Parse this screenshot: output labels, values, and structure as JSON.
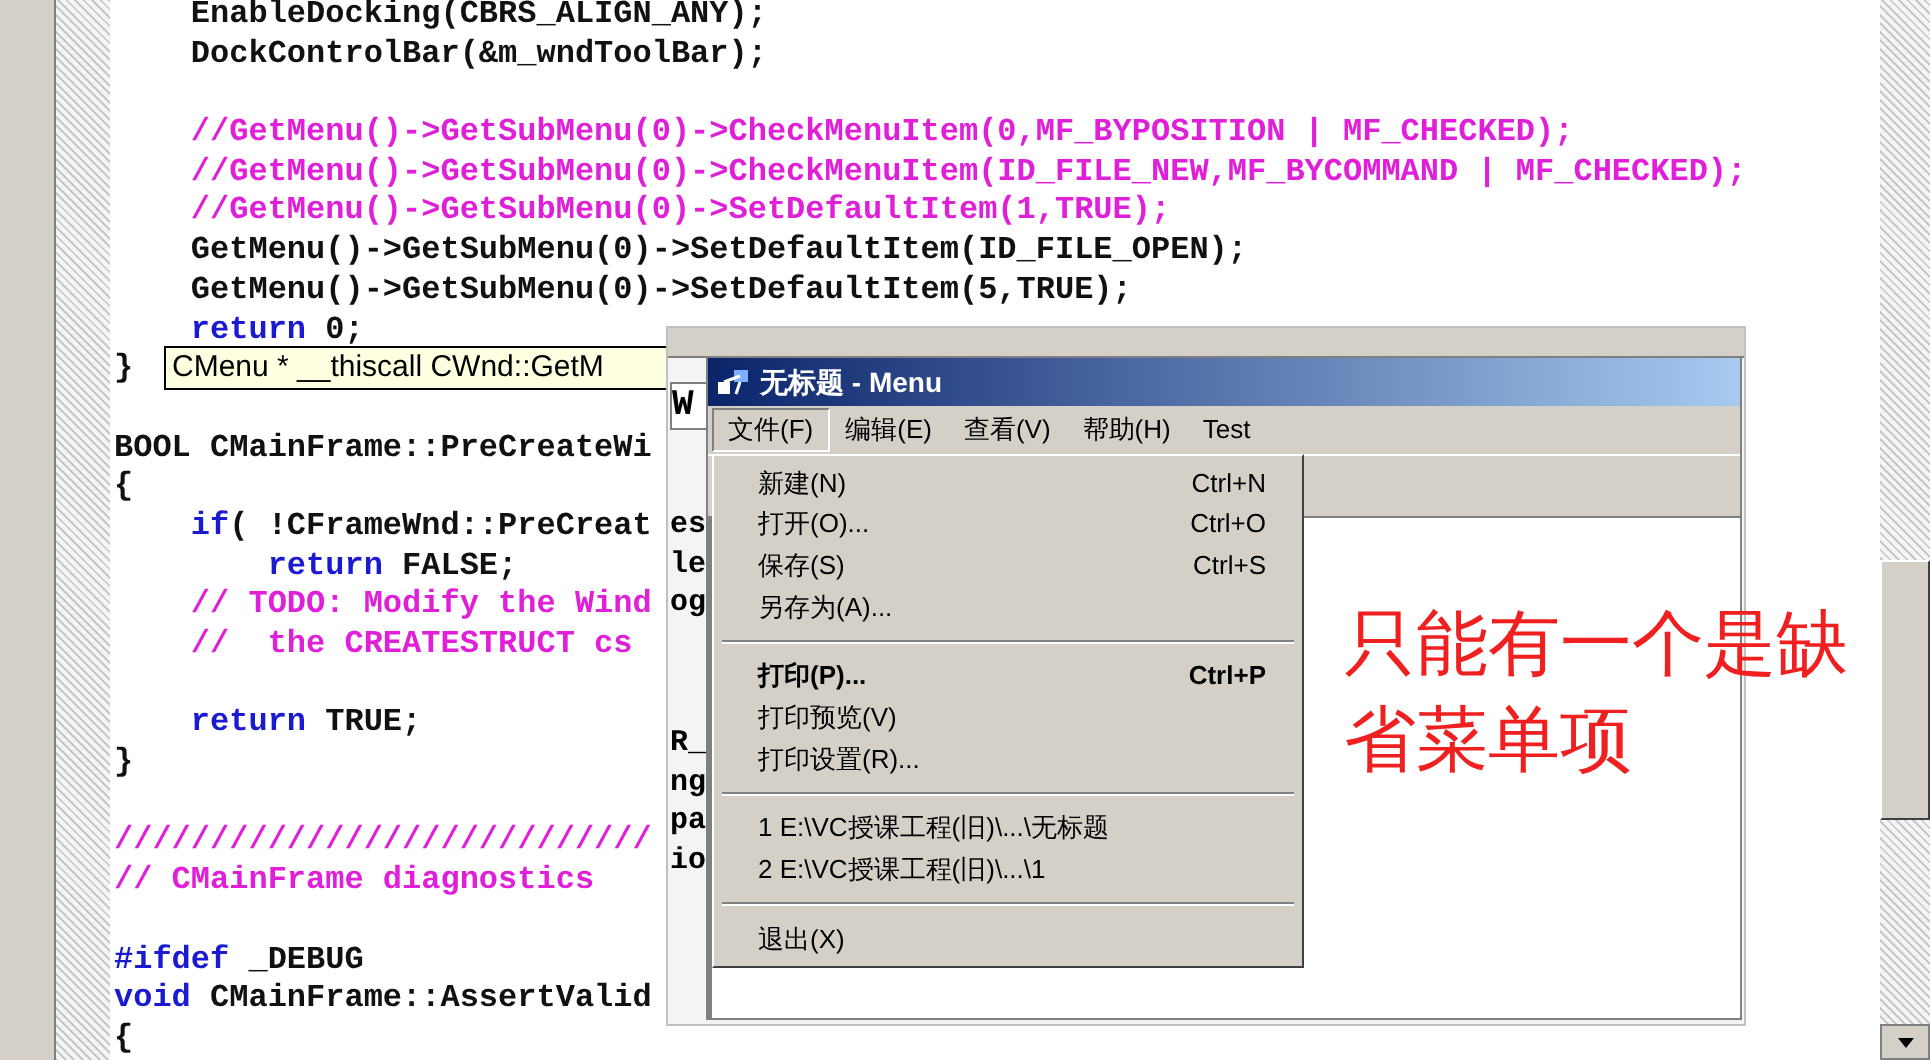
{
  "code_lines": [
    {
      "kind": "code",
      "tokens": [
        {
          "kind": "plain",
          "text": "    EnableDocking(CBRS_ALIGN_ANY);"
        }
      ]
    },
    {
      "kind": "code",
      "tokens": [
        {
          "kind": "plain",
          "text": "    DockControlBar(&m_wndToolBar);"
        }
      ]
    },
    {
      "kind": "blank"
    },
    {
      "kind": "code",
      "tokens": [
        {
          "kind": "comment",
          "text": "    //GetMenu()->GetSubMenu(0)->CheckMenuItem(0,MF_BYPOSITION | MF_CHECKED);"
        }
      ]
    },
    {
      "kind": "code",
      "tokens": [
        {
          "kind": "comment",
          "text": "    //GetMenu()->GetSubMenu(0)->CheckMenuItem(ID_FILE_NEW,MF_BYCOMMAND | MF_CHECKED);"
        }
      ]
    },
    {
      "kind": "code",
      "tokens": [
        {
          "kind": "comment",
          "text": "    //GetMenu()->GetSubMenu(0)->SetDefaultItem(1,TRUE);"
        }
      ]
    },
    {
      "kind": "code",
      "tokens": [
        {
          "kind": "plain",
          "text": "    GetMenu()->GetSubMenu(0)->SetDefaultItem(ID_FILE_OPEN);"
        }
      ]
    },
    {
      "kind": "code",
      "tokens": [
        {
          "kind": "plain",
          "text": "    GetMenu()->GetSubMenu(0)->SetDefaultItem(5,TRUE);"
        }
      ]
    },
    {
      "kind": "code",
      "tokens": [
        {
          "kind": "keyword",
          "text": "    return"
        },
        {
          "kind": "plain",
          "text": " 0;"
        }
      ]
    },
    {
      "kind": "code",
      "tokens": [
        {
          "kind": "plain",
          "text": "}"
        }
      ]
    },
    {
      "kind": "blank"
    },
    {
      "kind": "code",
      "tokens": [
        {
          "kind": "plain",
          "text": "BOOL CMainFrame::PreCreateWi"
        }
      ]
    },
    {
      "kind": "code",
      "tokens": [
        {
          "kind": "plain",
          "text": "{"
        }
      ]
    },
    {
      "kind": "code",
      "tokens": [
        {
          "kind": "keyword",
          "text": "    if"
        },
        {
          "kind": "plain",
          "text": "( !CFrameWnd::PreCreat"
        }
      ]
    },
    {
      "kind": "code",
      "tokens": [
        {
          "kind": "keyword",
          "text": "        return"
        },
        {
          "kind": "plain",
          "text": " FALSE;"
        }
      ]
    },
    {
      "kind": "code",
      "tokens": [
        {
          "kind": "comment",
          "text": "    // TODO: Modify the Wind"
        }
      ]
    },
    {
      "kind": "code",
      "tokens": [
        {
          "kind": "comment",
          "text": "    //  the CREATESTRUCT cs"
        }
      ]
    },
    {
      "kind": "blank"
    },
    {
      "kind": "code",
      "tokens": [
        {
          "kind": "keyword",
          "text": "    return"
        },
        {
          "kind": "plain",
          "text": " TRUE;"
        }
      ]
    },
    {
      "kind": "code",
      "tokens": [
        {
          "kind": "plain",
          "text": "}"
        }
      ]
    },
    {
      "kind": "blank"
    },
    {
      "kind": "code",
      "tokens": [
        {
          "kind": "comment",
          "text": "////////////////////////////"
        }
      ]
    },
    {
      "kind": "code",
      "tokens": [
        {
          "kind": "comment",
          "text": "// CMainFrame diagnostics"
        }
      ]
    },
    {
      "kind": "blank"
    },
    {
      "kind": "code",
      "tokens": [
        {
          "kind": "keyword",
          "text": "#ifdef"
        },
        {
          "kind": "plain",
          "text": " _DEBUG"
        }
      ]
    },
    {
      "kind": "code",
      "tokens": [
        {
          "kind": "keyword",
          "text": "void"
        },
        {
          "kind": "plain",
          "text": " CMainFrame::AssertValid"
        }
      ]
    },
    {
      "kind": "code",
      "tokens": [
        {
          "kind": "plain",
          "text": "{"
        }
      ]
    }
  ],
  "tooltip": "CMenu * __thiscall CWnd::GetM",
  "behind_panel": {
    "field": "W",
    "groups": [
      [
        "es",
        "le",
        "og"
      ],
      [
        "R_",
        "ng",
        "pa",
        "io"
      ]
    ]
  },
  "window": {
    "title": "无标题 - Menu",
    "menubar": [
      {
        "label": "文件(F)",
        "selected": true
      },
      {
        "label": "编辑(E)",
        "selected": false
      },
      {
        "label": "查看(V)",
        "selected": false
      },
      {
        "label": "帮助(H)",
        "selected": false
      },
      {
        "label": "Test",
        "selected": false
      }
    ],
    "dropdown": [
      {
        "kind": "item",
        "label": "新建(N)",
        "shortcut": "Ctrl+N",
        "default": false
      },
      {
        "kind": "item",
        "label": "打开(O)...",
        "shortcut": "Ctrl+O",
        "default": false
      },
      {
        "kind": "item",
        "label": "保存(S)",
        "shortcut": "Ctrl+S",
        "default": false
      },
      {
        "kind": "item",
        "label": "另存为(A)...",
        "default": false
      },
      {
        "kind": "separator"
      },
      {
        "kind": "item",
        "label": "打印(P)...",
        "shortcut": "Ctrl+P",
        "default": true
      },
      {
        "kind": "item",
        "label": "打印预览(V)",
        "default": false
      },
      {
        "kind": "item",
        "label": "打印设置(R)...",
        "default": false
      },
      {
        "kind": "separator"
      },
      {
        "kind": "item",
        "label": "1 E:\\VC授课工程(旧)\\...\\无标题",
        "default": false
      },
      {
        "kind": "item",
        "label": "2 E:\\VC授课工程(旧)\\...\\1",
        "default": false
      },
      {
        "kind": "separator"
      },
      {
        "kind": "item",
        "label": "退出(X)",
        "default": false
      }
    ]
  },
  "annotation": "只能有一个是缺省菜单项"
}
